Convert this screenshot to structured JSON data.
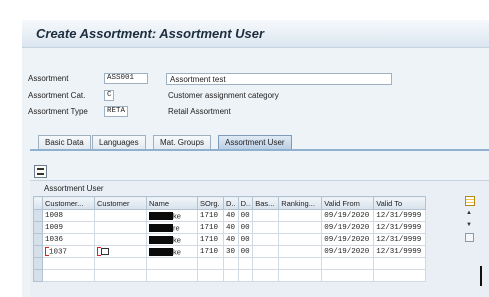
{
  "header": {
    "title": "Create Assortment: Assortment User"
  },
  "fields": [
    {
      "label": "Assortment",
      "value": "ASS001",
      "description": "Assortment test",
      "desc_is_input": true
    },
    {
      "label": "Assortment Cat.",
      "value": "C",
      "description": "Customer assignment category",
      "desc_is_input": false
    },
    {
      "label": "Assortment Type",
      "value": "RETA",
      "description": "Retail Assortment",
      "desc_is_input": false
    }
  ],
  "tabs": [
    {
      "label": "Basic Data",
      "active": false
    },
    {
      "label": "Languages",
      "active": false
    },
    {
      "label": "Mat. Groups",
      "active": false
    },
    {
      "label": "Assortment User",
      "active": true
    }
  ],
  "toolbar": {
    "details_icon": "details-icon"
  },
  "grid": {
    "title": "Assortment User",
    "columns": [
      "Customer...",
      "Customer",
      "Name",
      "SOrg.",
      "D..",
      "D..",
      "Bas...",
      "Ranking...",
      "Valid From",
      "Valid To"
    ],
    "rows": [
      {
        "customer_no": "1008",
        "customer": "",
        "name_visible": "ke",
        "sorg": "1710",
        "d1": "40",
        "d2": "00",
        "bas": "",
        "ranking": "",
        "valid_from": "09/19/2020",
        "valid_to": "12/31/9999"
      },
      {
        "customer_no": "1009",
        "customer": "",
        "name_visible": "re",
        "sorg": "1710",
        "d1": "40",
        "d2": "00",
        "bas": "",
        "ranking": "",
        "valid_from": "09/19/2020",
        "valid_to": "12/31/9999"
      },
      {
        "customer_no": "1036",
        "customer": "",
        "name_visible": "ke",
        "sorg": "1710",
        "d1": "40",
        "d2": "00",
        "bas": "",
        "ranking": "",
        "valid_from": "09/19/2020",
        "valid_to": "12/31/9999"
      },
      {
        "customer_no": "1037",
        "customer": "",
        "name_visible": "ke",
        "sorg": "1710",
        "d1": "30",
        "d2": "00",
        "bas": "",
        "ranking": "",
        "valid_from": "09/19/2020",
        "valid_to": "12/31/9999"
      }
    ],
    "empty_rows": 2
  },
  "colors": {
    "tab_active": "#b9cde2",
    "title_bar": "#dce6f0",
    "panel": "#e9eff5"
  }
}
